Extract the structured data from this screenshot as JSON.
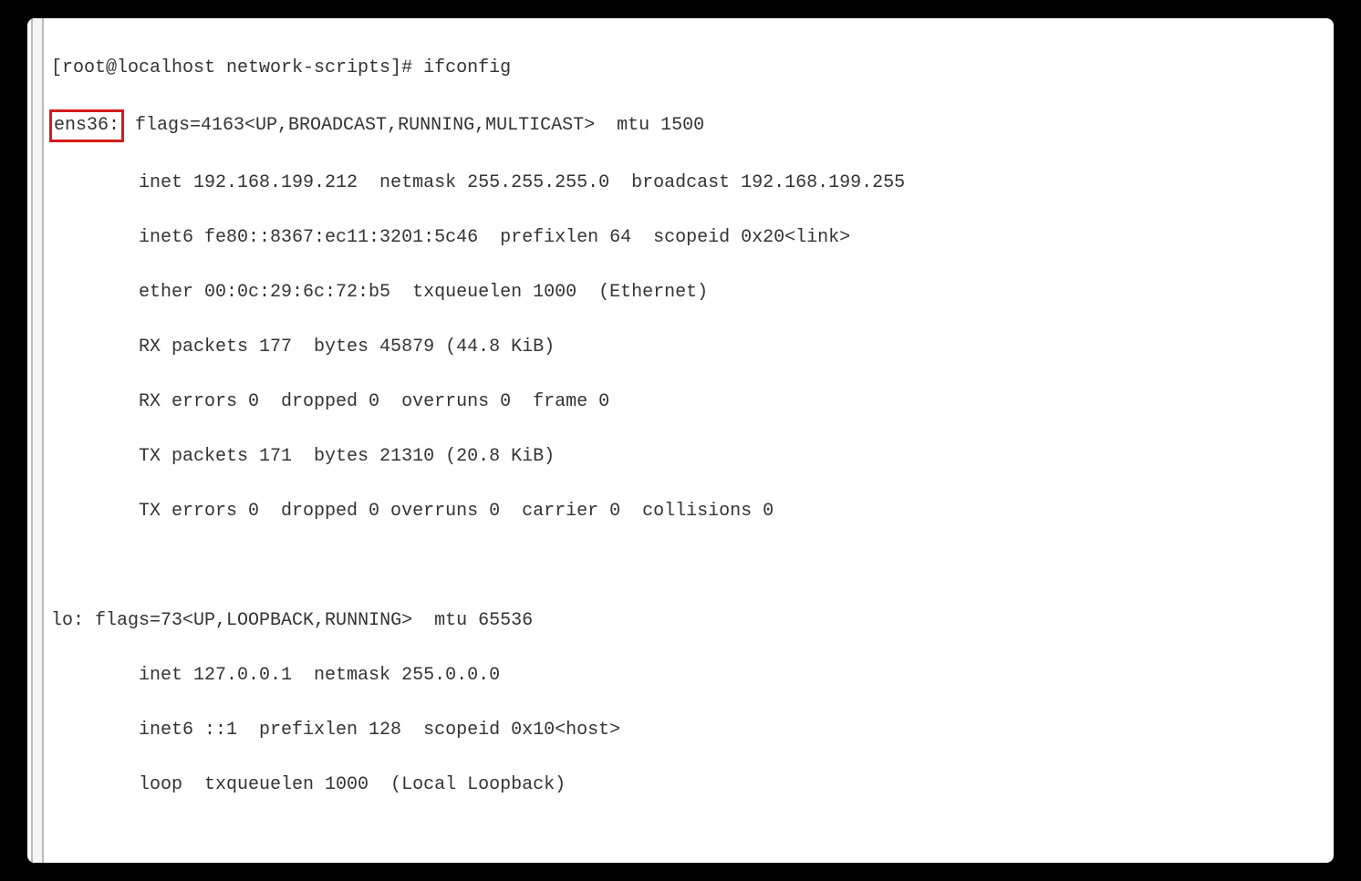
{
  "terminal": {
    "prompt": "[root@localhost network-scripts]# ",
    "command": "ifconfig",
    "interfaces": [
      {
        "name": "ens36:",
        "header": " flags=4163<UP,BROADCAST,RUNNING,MULTICAST>  mtu 1500",
        "lines": [
          "inet 192.168.199.212  netmask 255.255.255.0  broadcast 192.168.199.255",
          "inet6 fe80::8367:ec11:3201:5c46  prefixlen 64  scopeid 0x20<link>",
          "ether 00:0c:29:6c:72:b5  txqueuelen 1000  (Ethernet)",
          "RX packets 177  bytes 45879 (44.8 KiB)",
          "RX errors 0  dropped 0  overruns 0  frame 0",
          "TX packets 171  bytes 21310 (20.8 KiB)",
          "TX errors 0  dropped 0 overruns 0  carrier 0  collisions 0"
        ]
      },
      {
        "name": "lo:",
        "header": " flags=73<UP,LOOPBACK,RUNNING>  mtu 65536",
        "lines": [
          "inet 127.0.0.1  netmask 255.0.0.0",
          "inet6 ::1  prefixlen 128  scopeid 0x10<host>",
          "loop  txqueuelen 1000  (Local Loopback)"
        ]
      }
    ]
  }
}
